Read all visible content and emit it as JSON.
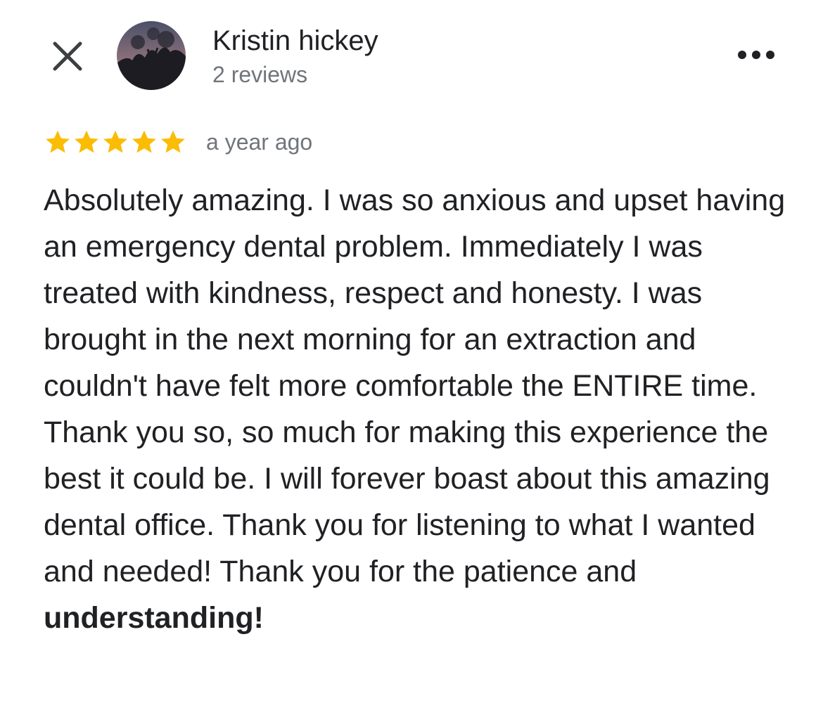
{
  "header": {
    "close_icon": "close-icon",
    "avatar_icon": "avatar",
    "more_icon": "more-horizontal-icon",
    "user_name": "Kristin hickey",
    "review_count": "2 reviews"
  },
  "review": {
    "rating": 5,
    "rating_max": 5,
    "star_icon": "star-icon",
    "star_color": "#fbbc04",
    "time": "a year ago",
    "text_main": "Absolutely amazing. I was so anxious and upset having an emergency dental problem. Immediately I was treated with kindness, respect and honesty. I was brought in the next morning for an extraction and couldn't have felt more comfortable the ENTIRE time. Thank you so, so much for making this experience the best it could be. I will forever boast about this amazing dental office. Thank you for listening to what I wanted and needed! Thank you for the patience and ",
    "text_emphasis": "understanding!"
  },
  "colors": {
    "text_primary": "#202124",
    "text_secondary": "#70757a",
    "star": "#fbbc04",
    "background": "#ffffff"
  }
}
